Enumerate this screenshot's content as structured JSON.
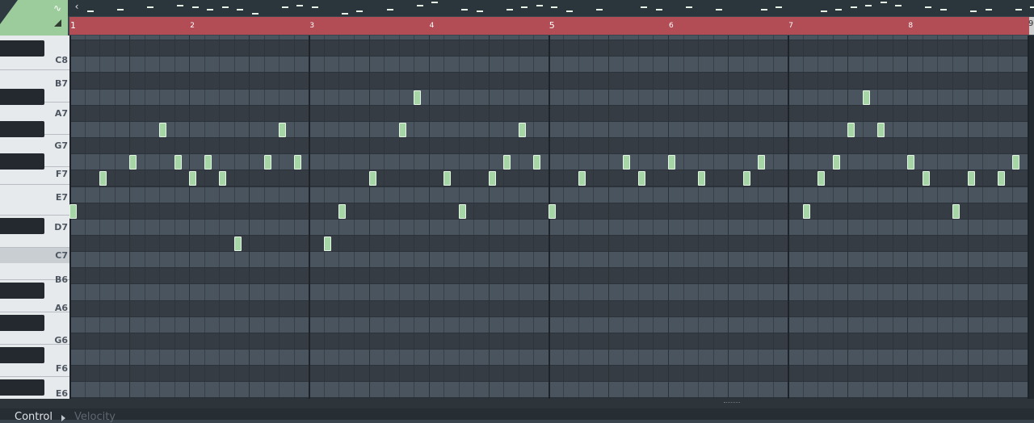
{
  "accent_colors": {
    "ruler": "#b34d55",
    "note": "#a6d6a6",
    "tool_corner": "#9ccc9c"
  },
  "tool_corner": {
    "curve_icon": "stamp-curve-icon",
    "curve_glyph": "∿",
    "triangle_icon": "corner-triangle-icon"
  },
  "overview": {
    "scroll_left_glyph": "‹"
  },
  "timeline": {
    "bar_numbers": [
      "1",
      "2",
      "3",
      "4",
      "5",
      "6",
      "7",
      "8"
    ],
    "end_number": "9"
  },
  "keyboard": {
    "labels": [
      "C8",
      "B7",
      "A7",
      "G7",
      "F7",
      "E7",
      "D7",
      "C7",
      "B6",
      "A6",
      "G6",
      "F6",
      "E6"
    ],
    "highlighted": "C7"
  },
  "notes": [
    {
      "pitch": "D7",
      "step": 0
    },
    {
      "pitch": "E7",
      "step": 2
    },
    {
      "pitch": "F7",
      "step": 4
    },
    {
      "pitch": "G7",
      "step": 6
    },
    {
      "pitch": "F7",
      "step": 7
    },
    {
      "pitch": "E7",
      "step": 8
    },
    {
      "pitch": "F7",
      "step": 9
    },
    {
      "pitch": "E7",
      "step": 10
    },
    {
      "pitch": "C7",
      "step": 11
    },
    {
      "pitch": "F7",
      "step": 13
    },
    {
      "pitch": "G7",
      "step": 14
    },
    {
      "pitch": "F7",
      "step": 15
    },
    {
      "pitch": "C7",
      "step": 17
    },
    {
      "pitch": "D7",
      "step": 18
    },
    {
      "pitch": "E7",
      "step": 20
    },
    {
      "pitch": "G7",
      "step": 22
    },
    {
      "pitch": "A7",
      "step": 23
    },
    {
      "pitch": "E7",
      "step": 25
    },
    {
      "pitch": "D7",
      "step": 26
    },
    {
      "pitch": "E7",
      "step": 28
    },
    {
      "pitch": "F7",
      "step": 29
    },
    {
      "pitch": "G7",
      "step": 30
    },
    {
      "pitch": "F7",
      "step": 31
    },
    {
      "pitch": "D7",
      "step": 32
    },
    {
      "pitch": "E7",
      "step": 34
    },
    {
      "pitch": "F7",
      "step": 37
    },
    {
      "pitch": "E7",
      "step": 38
    },
    {
      "pitch": "F7",
      "step": 40
    },
    {
      "pitch": "E7",
      "step": 42
    },
    {
      "pitch": "E7",
      "step": 45
    },
    {
      "pitch": "F7",
      "step": 46
    },
    {
      "pitch": "D7",
      "step": 49
    },
    {
      "pitch": "E7",
      "step": 50
    },
    {
      "pitch": "F7",
      "step": 51
    },
    {
      "pitch": "G7",
      "step": 52
    },
    {
      "pitch": "A7",
      "step": 53
    },
    {
      "pitch": "G7",
      "step": 54
    },
    {
      "pitch": "F7",
      "step": 56
    },
    {
      "pitch": "E7",
      "step": 57
    },
    {
      "pitch": "D7",
      "step": 59
    },
    {
      "pitch": "E7",
      "step": 60
    },
    {
      "pitch": "E7",
      "step": 62
    },
    {
      "pitch": "F7",
      "step": 63
    }
  ],
  "event_editor": {
    "control_label": "Control",
    "velocity_label": "Velocity"
  }
}
